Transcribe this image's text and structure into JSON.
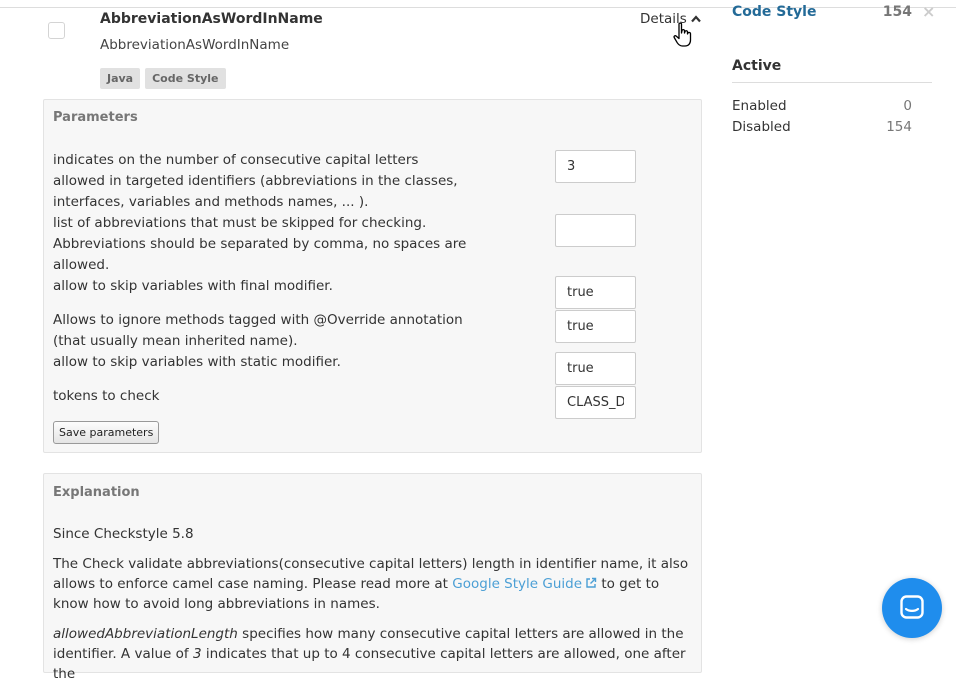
{
  "rule": {
    "title": "AbbreviationAsWordInName",
    "key": "AbbreviationAsWordInName",
    "tags": [
      "Java",
      "Code Style"
    ],
    "details_label": "Details"
  },
  "parameters": {
    "title": "Parameters",
    "items": [
      {
        "description": "indicates on the number of consecutive capital letters allowed in targeted identifiers (abbreviations in the classes, interfaces, variables and methods names, ... ).",
        "value": "3"
      },
      {
        "description": "list of abbreviations that must be skipped for checking. Abbreviations should be separated by comma, no spaces are allowed.",
        "value": ""
      },
      {
        "description": "allow to skip variables with final modifier.",
        "value": "true"
      },
      {
        "description": "Allows to ignore methods tagged with @Override annotation (that usually mean inherited name).",
        "value": "true"
      },
      {
        "description": "allow to skip variables with static modifier.",
        "value": "true"
      },
      {
        "description": "tokens to check",
        "value": "CLASS_DEF"
      }
    ],
    "save_label": "Save parameters"
  },
  "explanation": {
    "title": "Explanation",
    "since": "Since Checkstyle 5.8",
    "p1_before": "The Check validate abbreviations(consecutive capital letters) length in identifier name, it also allows to enforce camel case naming. Please read more at",
    "p1_link": "Google Style Guide",
    "p1_after": "to get to know how to avoid long abbreviations in names.",
    "p2_em": "allowedAbbreviationLength",
    "p2_text": "specifies how many consecutive capital letters are allowed in the identifier. A value of",
    "p2_em2": "3",
    "p2_text2": "indicates that up to 4 consecutive capital letters are allowed, one after the"
  },
  "sidebar": {
    "category": {
      "label": "Code Style",
      "count": "154"
    },
    "close_label": "×",
    "active": {
      "title": "Active",
      "items": [
        {
          "label": "Enabled",
          "count": "0"
        },
        {
          "label": "Disabled",
          "count": "154"
        }
      ]
    }
  },
  "colors": {
    "link": "#4b9fd5",
    "sidebar_category": "#236a97",
    "chat_button": "#1f8ded",
    "panel_bg": "#f7f7f7"
  }
}
